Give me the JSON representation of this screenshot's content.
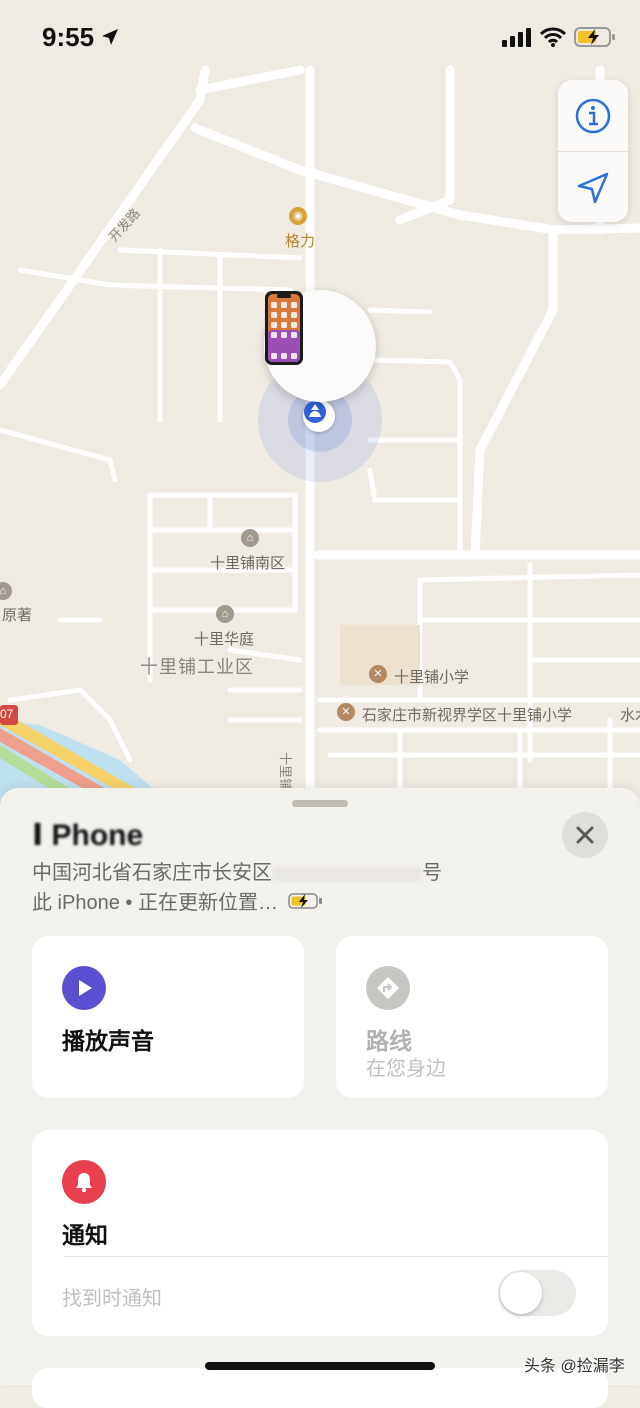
{
  "status_bar": {
    "time": "9:55"
  },
  "map": {
    "labels": {
      "geli": "格力",
      "kaifa_road": "开发路",
      "south_district": "十里铺南区",
      "huating": "十里华庭",
      "industrial": "十里铺工业区",
      "yuanzhu": "原著",
      "primary_school": "十里铺小学",
      "new_vision_school": "石家庄市新视界学区十里铺小学",
      "shuimu": "水木",
      "xi_road": "十里铺西街",
      "road_num": "07"
    }
  },
  "sheet": {
    "device_name": "Ⅰ Phone",
    "address": "中国河北省石家庄市长安区",
    "address_suffix": "号",
    "status": "此 iPhone • 正在更新位置…",
    "play_sound": {
      "label": "播放声音"
    },
    "directions": {
      "label": "路线",
      "sub": "在您身边"
    },
    "notifications": {
      "label": "通知",
      "row_label": "找到时通知"
    }
  },
  "watermark": "头条 @捡漏李",
  "colors": {
    "accent": "#4b5fc6",
    "bell": "#e8404f",
    "play": "#5b4fcf"
  }
}
